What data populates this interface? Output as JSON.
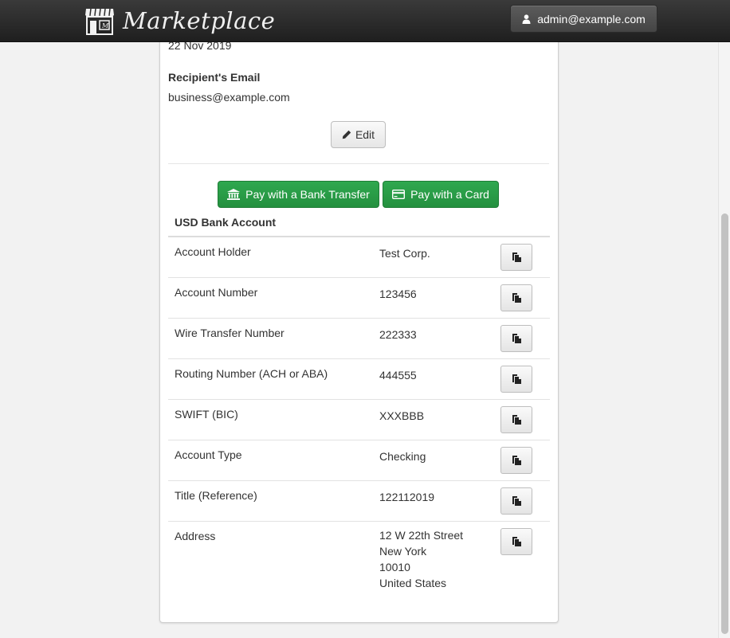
{
  "header": {
    "brand": "Marketplace",
    "user_button": "admin@example.com"
  },
  "details": {
    "date": "22 Nov 2019",
    "recipient_email_label": "Recipient's Email",
    "recipient_email": "business@example.com",
    "edit_label": "Edit"
  },
  "payment": {
    "bank_transfer_label": "Pay with a Bank Transfer",
    "card_label": "Pay with a Card"
  },
  "bank_account": {
    "title": "USD Bank Account",
    "rows": [
      {
        "label": "Account Holder",
        "value": "Test Corp."
      },
      {
        "label": "Account Number",
        "value": "123456"
      },
      {
        "label": "Wire Transfer Number",
        "value": "222333"
      },
      {
        "label": "Routing Number (ACH or ABA)",
        "value": "444555"
      },
      {
        "label": "SWIFT (BIC)",
        "value": "XXXBBB"
      },
      {
        "label": "Account Type",
        "value": "Checking"
      },
      {
        "label": "Title (Reference)",
        "value": "122112019"
      },
      {
        "label": "Address",
        "value_lines": [
          "12 W 22th Street",
          "New York",
          "10010",
          "United States"
        ]
      }
    ]
  },
  "icons": {
    "brand_logo": "storefront-icon",
    "user": "user-icon",
    "edit": "pencil-icon",
    "bank": "bank-icon",
    "card": "credit-card-icon",
    "copy": "copy-icon"
  },
  "colors": {
    "navbar": "#2a2a2a",
    "pay_button": "#28a046",
    "page_background": "#f2f2f2"
  }
}
